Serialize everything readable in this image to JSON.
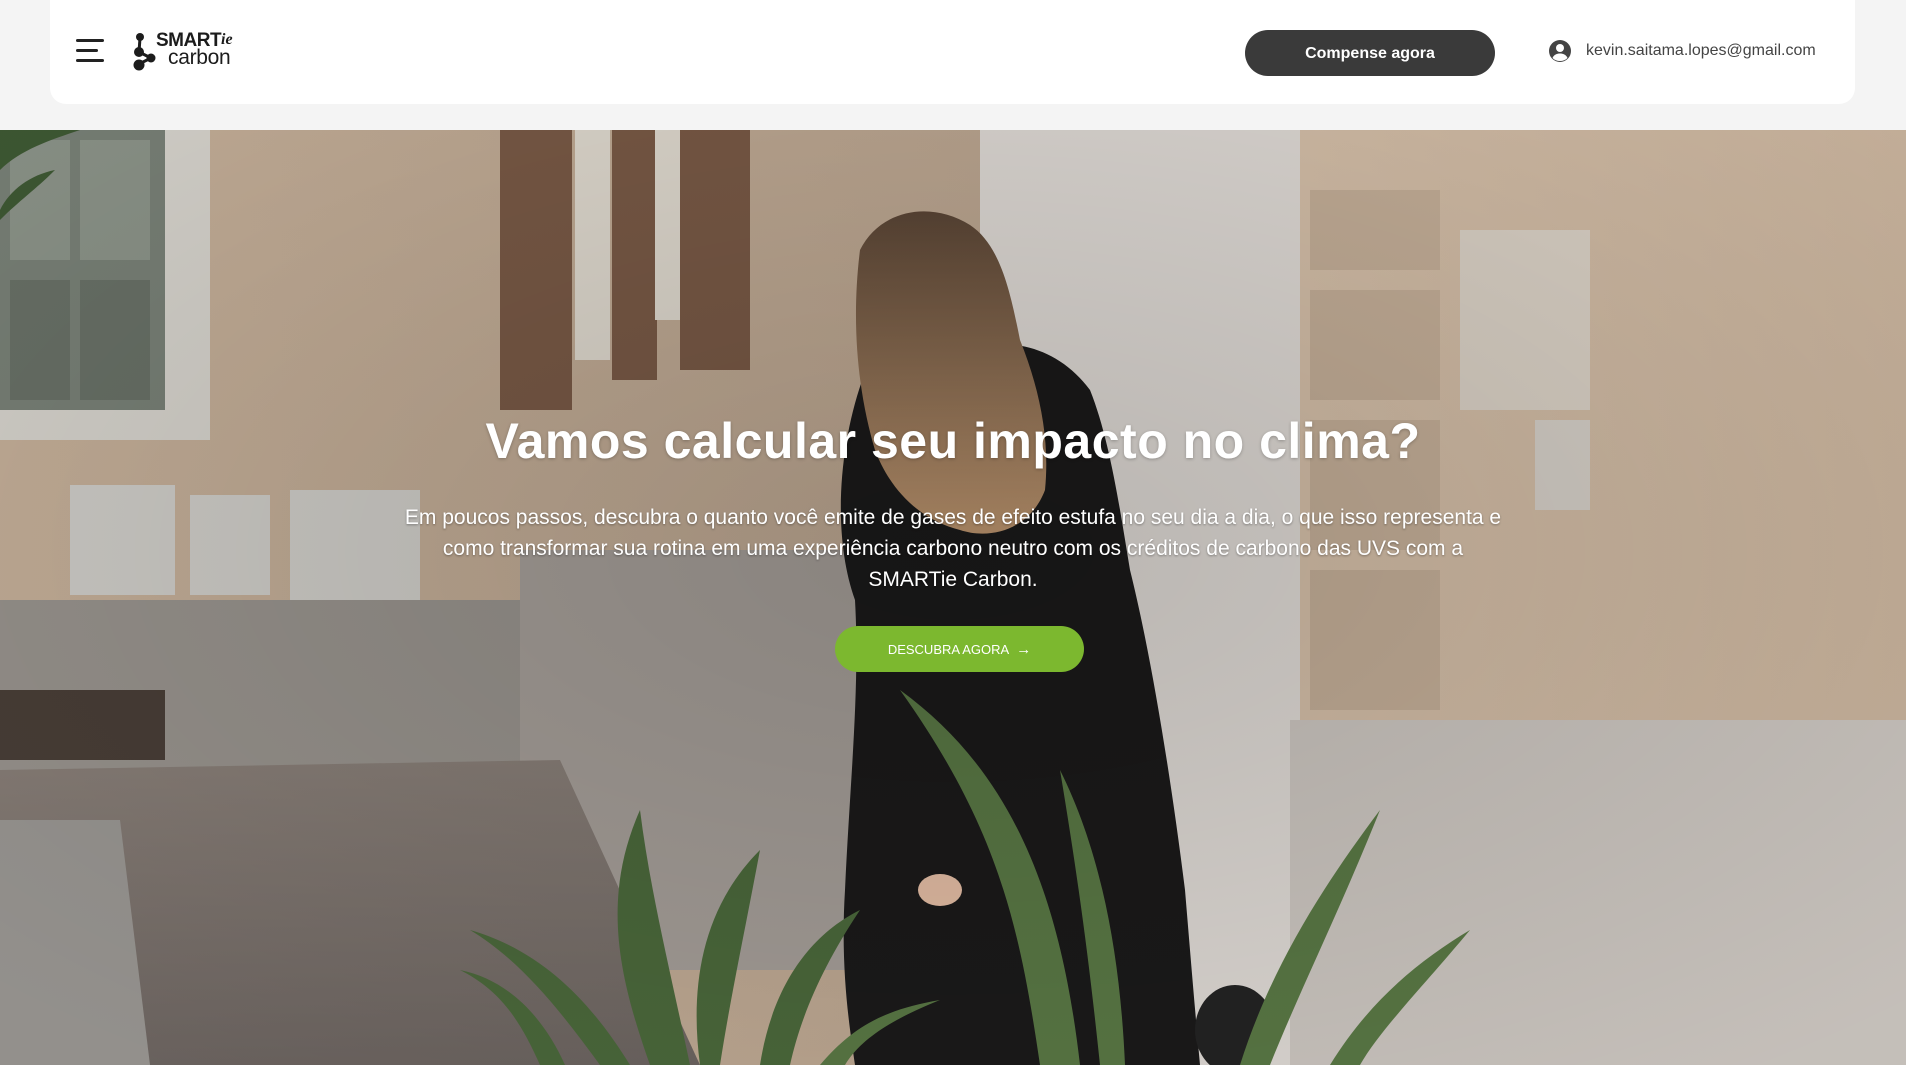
{
  "brand": {
    "logo_main": "SMART",
    "logo_suffix": "ie",
    "logo_sub": "carbon"
  },
  "header": {
    "menu_icon": "hamburger-menu-icon",
    "cta_label": "Compense agora",
    "user_icon": "account-circle-icon",
    "user_email": "kevin.saitama.lopes@gmail.com"
  },
  "hero": {
    "title": "Vamos calcular seu impacto no clima?",
    "subtitle": "Em poucos passos, descubra o quanto você emite de gases de efeito estufa no seu dia a dia, o que isso representa e como transformar sua rotina em uma experiência carbono neutro com os créditos de carbono das UVS com a SMARTie Carbon.",
    "cta_label": "DESCUBRA AGORA",
    "cta_icon": "arrow-right-icon"
  },
  "colors": {
    "header_bg": "#ffffff",
    "page_bg": "#f4f4f4",
    "header_cta_bg": "#3a3a3a",
    "hero_cta_bg": "#7cb82f",
    "text_dark": "#1c1c1c"
  }
}
